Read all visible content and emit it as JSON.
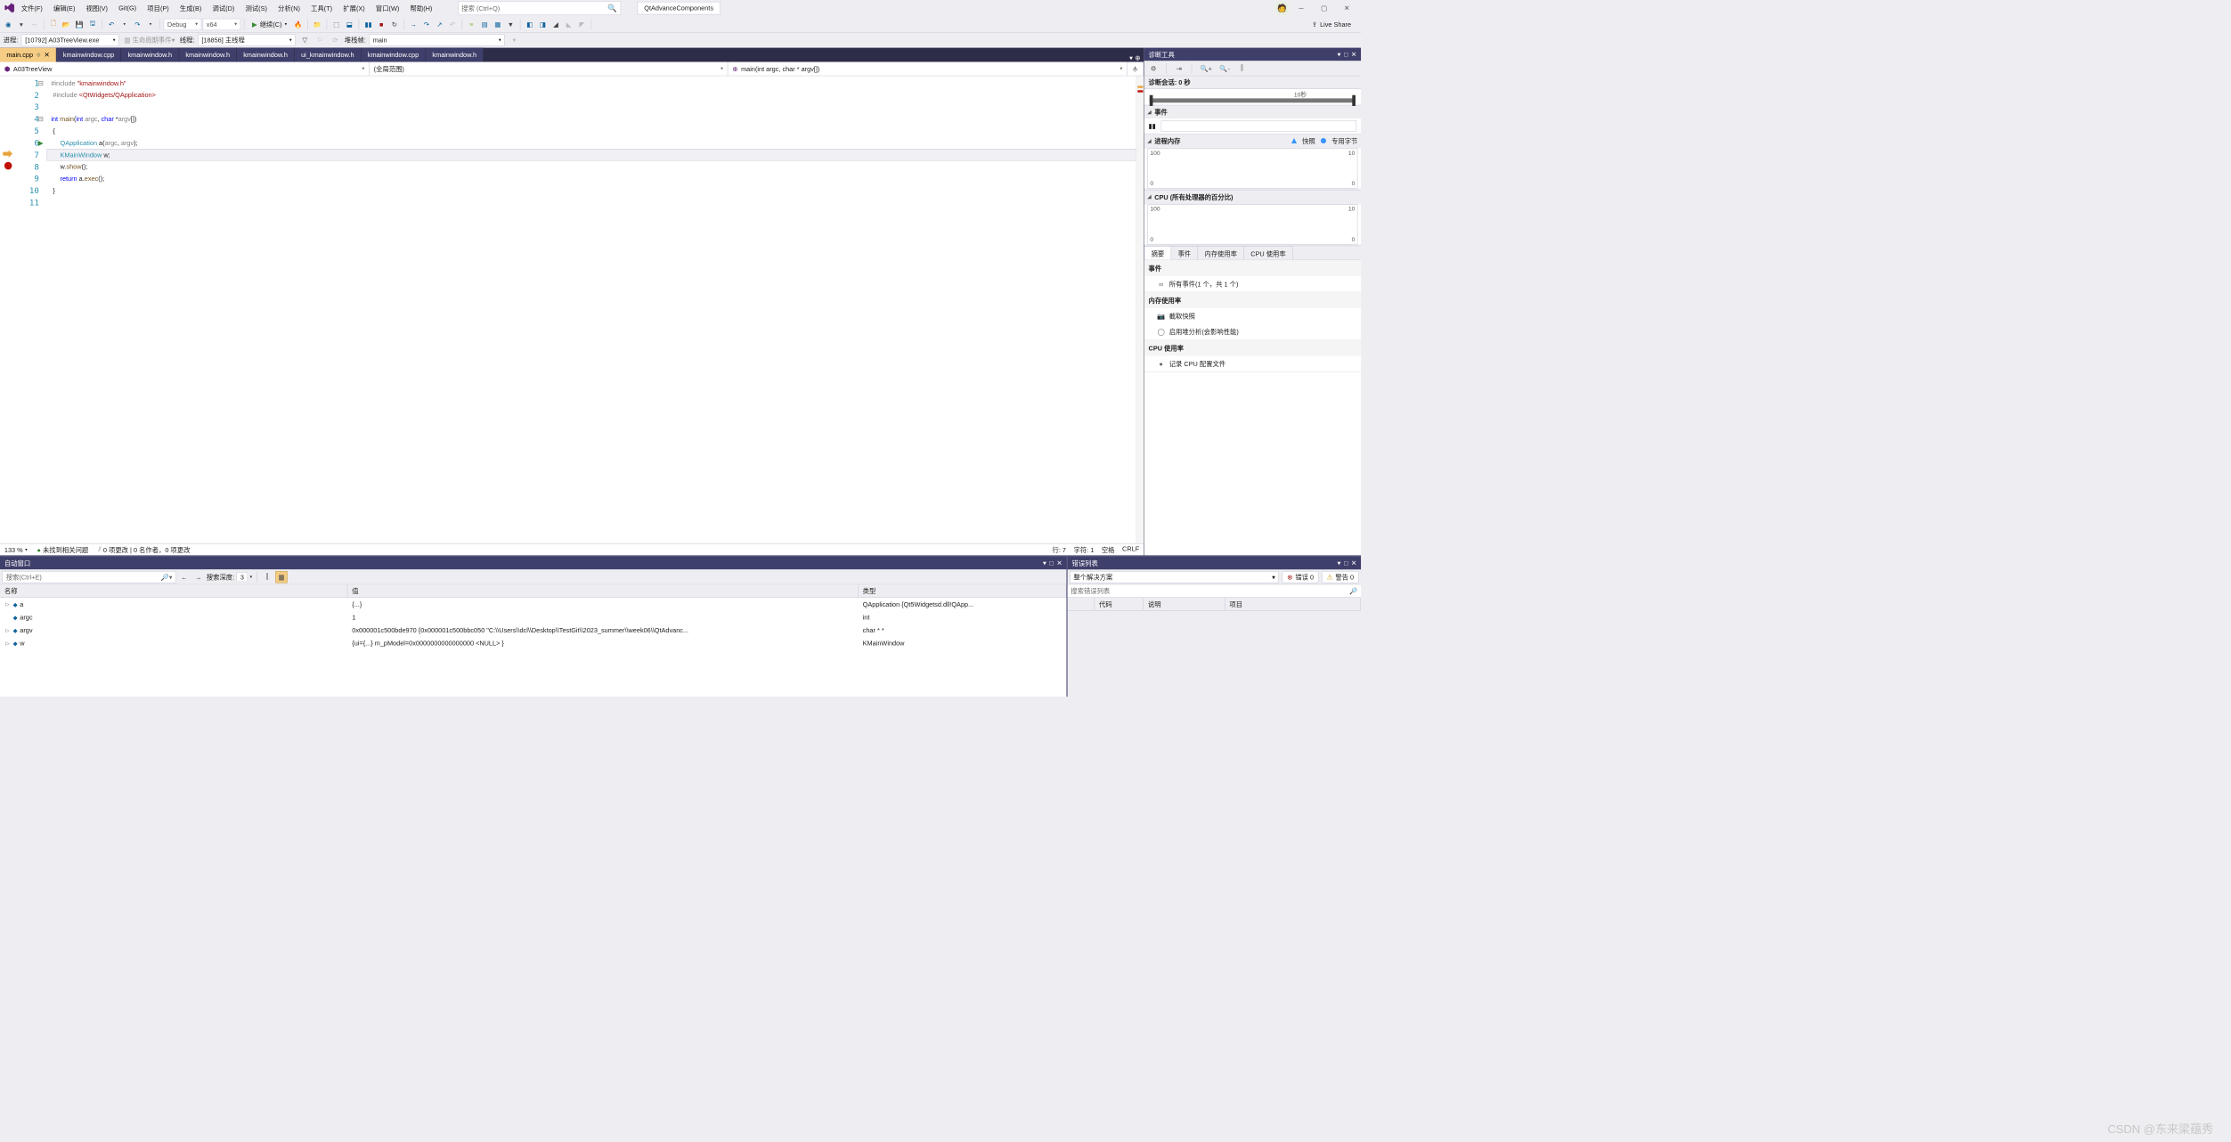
{
  "menu": {
    "file": "文件(F)",
    "edit": "编辑(E)",
    "view": "视图(V)",
    "git": "Git(G)",
    "project": "项目(P)",
    "build": "生成(B)",
    "debug": "调试(D)",
    "test": "测试(S)",
    "analyze": "分析(N)",
    "tools": "工具(T)",
    "extensions": "扩展(X)",
    "window": "窗口(W)",
    "help": "帮助(H)",
    "search_placeholder": "搜索 (Ctrl+Q)",
    "solution": "QtAdvanceComponents"
  },
  "toolbar": {
    "config": "Debug",
    "platform": "x64",
    "continue": "继续(C)",
    "live_share": "Live Share"
  },
  "debugbar": {
    "process_label": "进程:",
    "process": "[10792] A03TreeView.exe",
    "lifecycle": "生命周期事件",
    "thread_label": "线程:",
    "thread": "[18856] 主线程",
    "stack_label": "堆栈帧:",
    "stack": "main"
  },
  "tabs": [
    {
      "label": "main.cpp"
    },
    {
      "label": "kmainwindow.cpp"
    },
    {
      "label": "kmainwindow.h"
    },
    {
      "label": "kmainwindow.h"
    },
    {
      "label": "kmainwindow.h"
    },
    {
      "label": "ui_kmainwindow.h"
    },
    {
      "label": "kmainwindow.cpp"
    },
    {
      "label": "kmainwindow.h"
    }
  ],
  "nav": {
    "project": "A03TreeView",
    "scope": "(全局范围)",
    "member": "main(int argc, char * argv[])"
  },
  "code": {
    "include1": "\"kmainwindow.h\"",
    "include2": "<QtWidgets/QApplication>",
    "lines": [
      {
        "n": "1"
      },
      {
        "n": "2"
      },
      {
        "n": "3"
      },
      {
        "n": "4"
      },
      {
        "n": "5"
      },
      {
        "n": "6"
      },
      {
        "n": "7"
      },
      {
        "n": "8"
      },
      {
        "n": "9"
      },
      {
        "n": "10"
      },
      {
        "n": "11"
      }
    ]
  },
  "status": {
    "zoom": "133 %",
    "issues": "未找到相关问题",
    "changes": "0 项更改 | 0 名作者，0 项更改",
    "line": "行: 7",
    "col": "字符: 1",
    "ins": "空格",
    "eol": "CRLF"
  },
  "diag": {
    "title": "诊断工具",
    "session": "诊断会话: 0 秒",
    "time_tick": "10秒",
    "events_hdr": "事件",
    "mem_hdr": "进程内存",
    "legend_snap": "快照",
    "legend_priv": "专用字节",
    "mem_max": "100",
    "mem_min": "0",
    "mem_max_r": "10",
    "mem_min_r": "0",
    "cpu_hdr": "CPU (所有处理器的百分比)",
    "cpu_max": "100",
    "cpu_min": "0",
    "cpu_max_r": "10",
    "cpu_min_r": "0",
    "tabs": [
      "摘要",
      "事件",
      "内存使用率",
      "CPU 使用率"
    ],
    "sum": {
      "events_h": "事件",
      "events_i": "所有事件(1 个，共 1 个)",
      "mem_h": "内存使用率",
      "mem_i1": "截取快照",
      "mem_i2": "启用堆分析(会影响性能)",
      "cpu_h": "CPU 使用率",
      "cpu_i": "记录 CPU 配置文件"
    }
  },
  "autos": {
    "title": "自动窗口",
    "search_ph": "搜索(Ctrl+E)",
    "depth_label": "搜索深度:",
    "depth": "3",
    "cols": [
      "名称",
      "值",
      "类型"
    ],
    "rows": [
      {
        "name": "a",
        "value": "{...}",
        "type": "QApplication {Qt5Widgetsd.dll!QApp..."
      },
      {
        "name": "argc",
        "value": "1",
        "type": "int"
      },
      {
        "name": "argv",
        "value": "0x000001c500bde970 {0x000001c500bbc050 \"C:\\\\Users\\\\dcl\\\\Desktop\\\\TestGit\\\\2023_summer\\\\week06\\\\QtAdvanc...",
        "type": "char * *"
      },
      {
        "name": "w",
        "value": "{ui={...} m_pModel=0x0000000000000000 <NULL> }",
        "type": "KMainWindow"
      }
    ]
  },
  "errlist": {
    "title": "错误列表",
    "scope": "整个解决方案",
    "errors": "错误 0",
    "warnings": "警告 0",
    "search_ph": "搜索错误列表",
    "cols": [
      "代码",
      "说明",
      "项目"
    ]
  },
  "watermark": "CSDN @东来梁蕴秀"
}
